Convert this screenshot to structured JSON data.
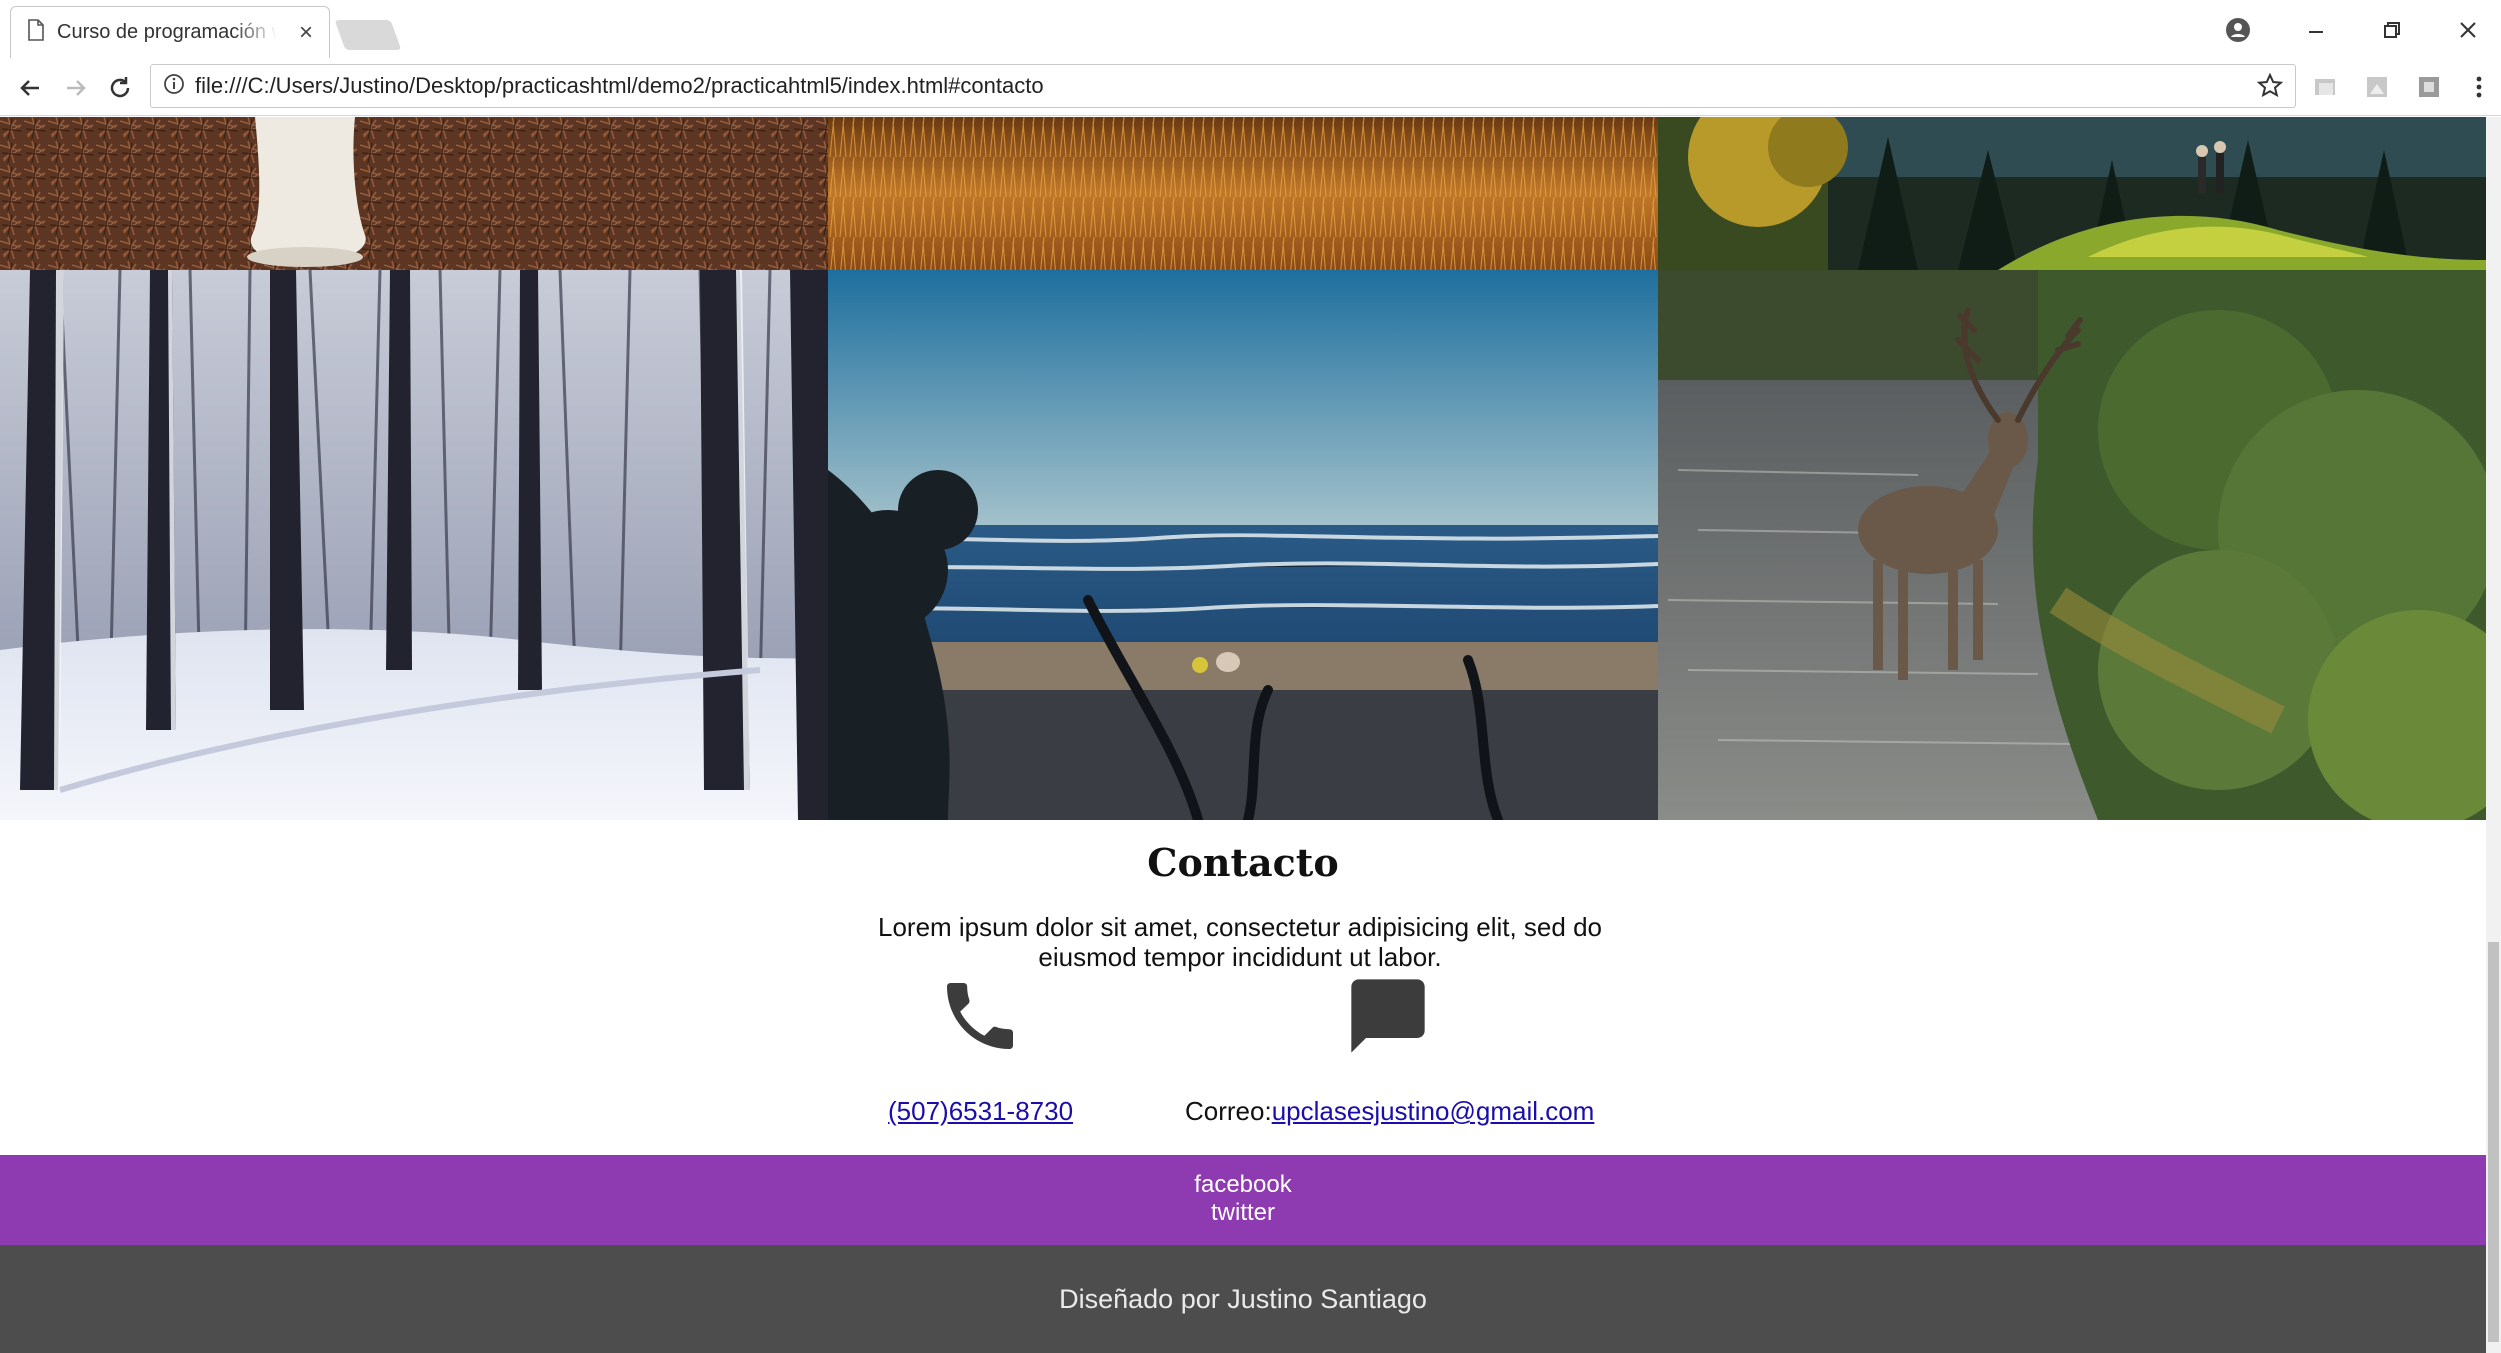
{
  "browser": {
    "tab_title": "Curso de programación w",
    "address": "file:///C:/Users/Justino/Desktop/practicashtml/demo2/practicahtml5/index.html#contacto"
  },
  "gallery": {
    "images": [
      {
        "label": "",
        "scene": "pine-needles-mushroom"
      },
      {
        "label": "",
        "scene": "golden-grass"
      },
      {
        "label": "",
        "scene": "forest-hikers"
      },
      {
        "label": "",
        "scene": "snowy-forest"
      },
      {
        "label": "",
        "scene": "beach-sea"
      },
      {
        "label": "",
        "scene": "deer-river"
      }
    ]
  },
  "contact": {
    "title": "Contacto",
    "text": "Lorem ipsum dolor sit amet, consectetur adipisicing elit, sed do eiusmod tempor incididunt ut labor.",
    "phone_icon": "phone-icon",
    "chat_icon": "chat-bubble-icon",
    "phone": "(507)6531-8730",
    "email_label": "Correo:",
    "email": "upclasesjustino@gmail.com"
  },
  "social": {
    "facebook": "facebook",
    "twitter": "twitter"
  },
  "footer": {
    "text": "Diseñado por Justino Santiago"
  },
  "colors": {
    "social_bg": "#8e3ab1",
    "footer_bg": "#4d4d4d",
    "link": "#1a0dab"
  }
}
